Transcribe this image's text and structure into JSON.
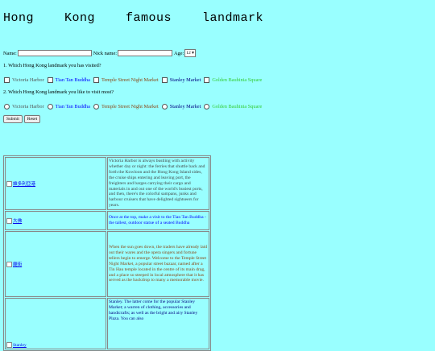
{
  "title": "Hong    Kong    famous    landmark",
  "form": {
    "name_label": "Name:",
    "nick_label": "Nick name:",
    "age_label": "Age:",
    "age_value": "12",
    "q1": "1. Which Hong Kong landmark you has visited?",
    "q2": "2. Which Hong Kong landmark you like to visit most?",
    "options": [
      "Victoria Harbor",
      "Tian Tan Buddha",
      "Temple Street Night Market",
      "Stanley Market",
      "Golden Bauhinia Square"
    ],
    "submit": "Submit",
    "reset": "Reset"
  },
  "colors": {
    "background": "#99ffff",
    "opt1": "#555555",
    "opt2": "#0000ff",
    "opt3": "#8b4513",
    "opt4": "#000080",
    "opt5": "#33cc33"
  },
  "table": {
    "rows": [
      {
        "img_alt": "維多利亞港",
        "text": "Victoria Harbor is always bustling with activity whether day or night: the ferries that shuttle back and forth the Kowloon and the Hong Kong Island sides, the cruise ships entering and leaving port, the freighters and barges carrying their cargo and materials in and out one of the world's busiest ports, and then, there's the colorful sampans, junks and harbour cruisers that have delighted sightseers for years.",
        "color": "#444444"
      },
      {
        "img_alt": "大佛",
        "text": "Once at the top, make a visit to the Tian Tan Buddha - the tallest, outdoor statue of a seated Buddha",
        "color": "#0000ff"
      },
      {
        "img_alt": "廟街",
        "text": "When the sun goes down, the traders have already laid out their wares and the opera singers and fortune tellers begin to emerge. Welcome to the Temple Street Night Market, a popular street bazaar, named after a Tin Hau temple located in the centre of its main drag, and a place so steeped in local atmosphere that it has served as the backdrop to many a memorable movie.",
        "color": "#8b4513"
      },
      {
        "img_alt": "Stanley",
        "text": "Stanley. The latter come for the popular Stanley Market; a warren of clothing, accessories and handicrafts; as well as the bright and airy Stanley Plaza. You can also",
        "color": "#000080"
      }
    ]
  }
}
